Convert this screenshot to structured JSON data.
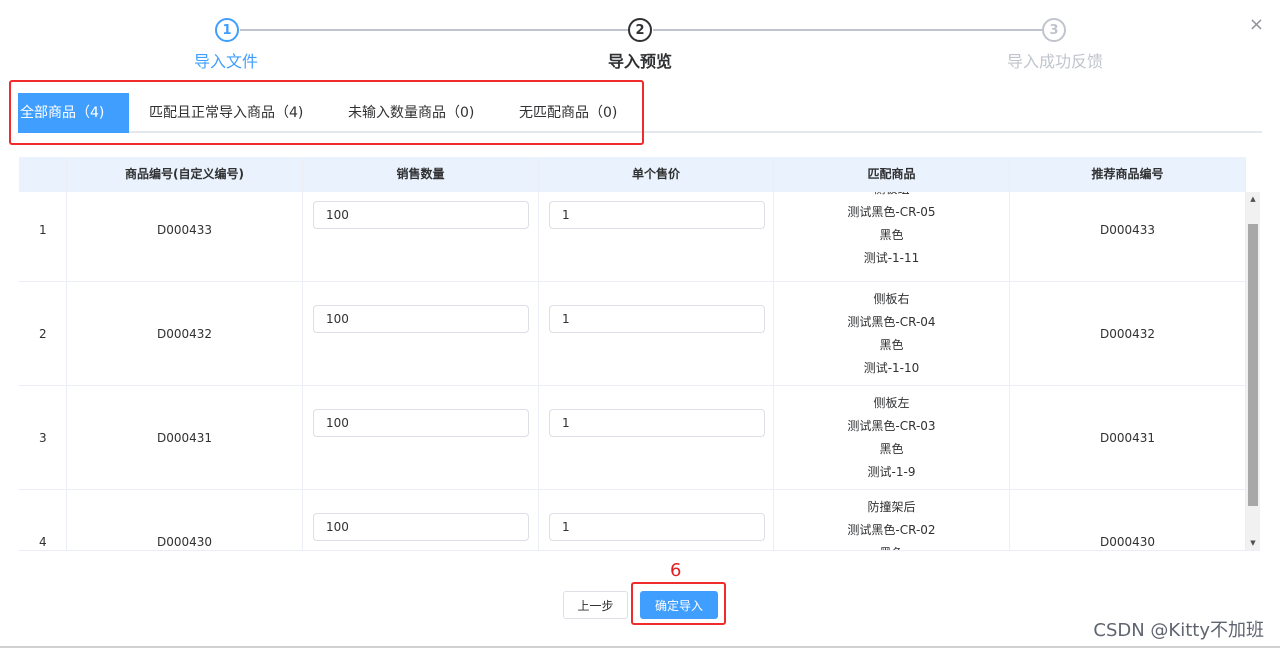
{
  "steps": [
    {
      "number": "1",
      "label": "导入文件"
    },
    {
      "number": "2",
      "label": "导入预览"
    },
    {
      "number": "3",
      "label": "导入成功反馈"
    }
  ],
  "close_icon": "×",
  "tabs": [
    {
      "label": "全部商品（4)"
    },
    {
      "label": "匹配且正常导入商品（4)"
    },
    {
      "label": "未输入数量商品（0)"
    },
    {
      "label": "无匹配商品（0)"
    }
  ],
  "table": {
    "headers": [
      "",
      "商品编号(自定义编号)",
      "销售数量",
      "单个售价",
      "匹配商品",
      "推荐商品编号"
    ],
    "rows": [
      {
        "index": "1",
        "code": "D000433",
        "qty": "100",
        "price": "1",
        "match": [
          "侧板组",
          "测试黑色-CR-05",
          "黑色",
          "测试-1-11"
        ],
        "recommend": "D000433"
      },
      {
        "index": "2",
        "code": "D000432",
        "qty": "100",
        "price": "1",
        "match": [
          "侧板右",
          "测试黑色-CR-04",
          "黑色",
          "测试-1-10"
        ],
        "recommend": "D000432"
      },
      {
        "index": "3",
        "code": "D000431",
        "qty": "100",
        "price": "1",
        "match": [
          "侧板左",
          "测试黑色-CR-03",
          "黑色",
          "测试-1-9"
        ],
        "recommend": "D000431"
      },
      {
        "index": "4",
        "code": "D000430",
        "qty": "100",
        "price": "1",
        "match": [
          "防撞架后",
          "测试黑色-CR-02",
          "黑色"
        ],
        "recommend": "D000430"
      }
    ]
  },
  "footer": {
    "prev_label": "上一步",
    "confirm_label": "确定导入",
    "annotation_number": "6"
  },
  "watermark": "CSDN @Kitty不加班",
  "colors": {
    "accent": "#409eff",
    "highlight": "#f02b2b"
  }
}
